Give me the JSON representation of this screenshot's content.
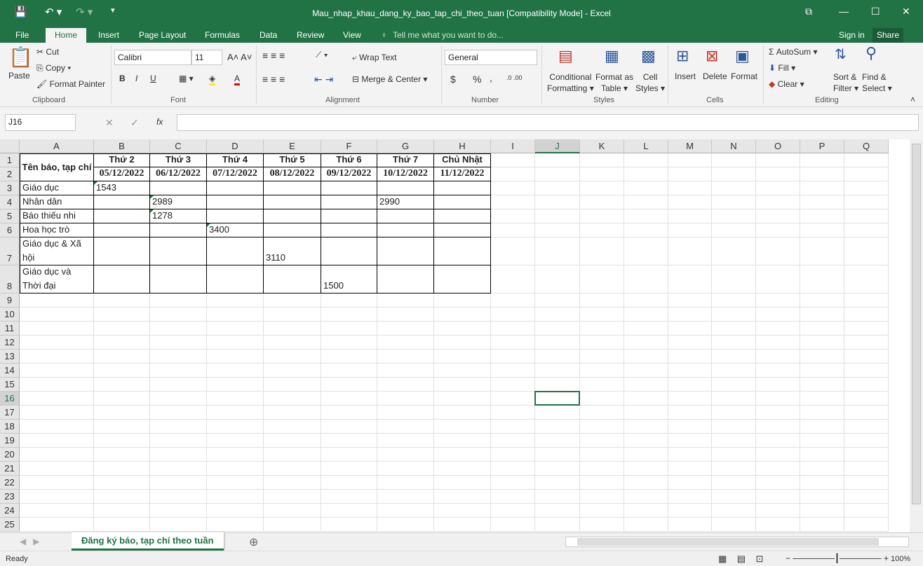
{
  "window": {
    "title": "Mau_nhap_khau_dang_ky_bao_tap_chi_theo_tuan  [Compatibility Mode] - Excel"
  },
  "tabs": [
    "File",
    "Home",
    "Insert",
    "Page Layout",
    "Formulas",
    "Data",
    "Review",
    "View"
  ],
  "tell_me": "Tell me what you want to do...",
  "sign_in": "Sign in",
  "share": "Share",
  "ribbon": {
    "clipboard": {
      "paste": "Paste",
      "cut": "Cut",
      "copy": "Copy",
      "format_painter": "Format Painter",
      "label": "Clipboard"
    },
    "font": {
      "name": "Calibri",
      "size": "11",
      "bold": "B",
      "italic": "I",
      "underline": "U",
      "label": "Font"
    },
    "alignment": {
      "wrap": "Wrap Text",
      "merge": "Merge & Center",
      "label": "Alignment"
    },
    "number": {
      "format": "General",
      "currency": "$",
      "percent": "%",
      "comma": ",",
      "label": "Number"
    },
    "styles": {
      "cond": "Conditional",
      "cond2": "Formatting",
      "table": "Format as",
      "table2": "Table",
      "cell": "Cell",
      "cell2": "Styles",
      "label": "Styles"
    },
    "cells": {
      "insert": "Insert",
      "delete": "Delete",
      "format": "Format",
      "label": "Cells"
    },
    "editing": {
      "autosum": "AutoSum",
      "fill": "Fill",
      "clear": "Clear",
      "sort": "Sort &",
      "sort2": "Filter",
      "find": "Find &",
      "find2": "Select",
      "label": "Editing"
    }
  },
  "formula_bar": {
    "name_box": "J16",
    "fx": "fx",
    "value": ""
  },
  "columns": [
    "A",
    "B",
    "C",
    "D",
    "E",
    "F",
    "G",
    "H",
    "I",
    "J",
    "K",
    "L",
    "M",
    "N",
    "O",
    "P",
    "Q"
  ],
  "rows": [
    "1",
    "2",
    "3",
    "4",
    "5",
    "6",
    "7",
    "8",
    "9",
    "10",
    "11",
    "12",
    "13",
    "14",
    "15",
    "16",
    "17",
    "18",
    "19",
    "20",
    "21",
    "22",
    "23",
    "24",
    "25"
  ],
  "table": {
    "header": "Tên báo, tạp chí",
    "days": [
      "Thứ 2",
      "Thứ 3",
      "Thứ 4",
      "Thứ 5",
      "Thứ 6",
      "Thứ 7",
      "Chủ Nhật"
    ],
    "dates": [
      "05/12/2022",
      "06/12/2022",
      "07/12/2022",
      "08/12/2022",
      "09/12/2022",
      "10/12/2022",
      "11/12/2022"
    ],
    "rows": [
      {
        "name": "Giáo dục",
        "values": [
          "1543",
          "",
          "",
          "",
          "",
          "",
          ""
        ]
      },
      {
        "name": "Nhân dân",
        "values": [
          "",
          "2989",
          "",
          "",
          "",
          "2990",
          ""
        ]
      },
      {
        "name": "Báo thiếu nhi",
        "values": [
          "",
          "1278",
          "",
          "",
          "",
          "",
          ""
        ]
      },
      {
        "name": "Hoa học trò",
        "values": [
          "",
          "",
          "3400",
          "",
          "",
          "",
          ""
        ]
      },
      {
        "name": "Giáo dục & Xã hội",
        "values": [
          "",
          "",
          "",
          "3110",
          "",
          "",
          ""
        ]
      },
      {
        "name": "Giáo dục và Thời đại",
        "values": [
          "",
          "",
          "",
          "",
          "1500",
          "",
          ""
        ]
      }
    ]
  },
  "sheet_tab": "Đăng ký báo, tạp chí theo tuần",
  "status": {
    "ready": "Ready",
    "zoom": "100%"
  }
}
